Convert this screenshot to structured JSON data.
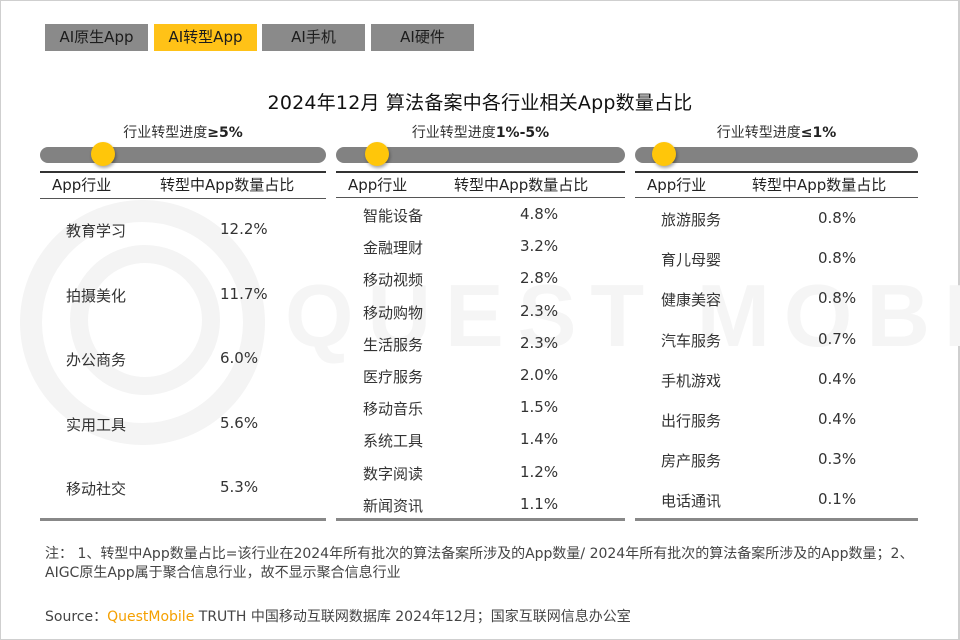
{
  "tabs": [
    {
      "label": "AI原生App",
      "active": false
    },
    {
      "label": "AI转型App",
      "active": true
    },
    {
      "label": "AI手机",
      "active": false
    },
    {
      "label": "AI硬件",
      "active": false
    }
  ],
  "title": "2024年12月 算法备案中各行业相关App数量占比",
  "watermark": "QUEST MOBILE",
  "columns": {
    "industry": "App行业",
    "share": "转型中App数量占比"
  },
  "panels": [
    {
      "caption_prefix": "行业转型进度",
      "caption_value": "≥5%",
      "slider_level": 0.18,
      "rows": [
        {
          "name": "教育学习",
          "value": "12.2%"
        },
        {
          "name": "拍摄美化",
          "value": "11.7%"
        },
        {
          "name": "办公商务",
          "value": "6.0%"
        },
        {
          "name": "实用工具",
          "value": "5.6%"
        },
        {
          "name": "移动社交",
          "value": "5.3%"
        }
      ]
    },
    {
      "caption_prefix": "行业转型进度",
      "caption_value": "1%-5%",
      "slider_level": 0.1,
      "rows": [
        {
          "name": "智能设备",
          "value": "4.8%"
        },
        {
          "name": "金融理财",
          "value": "3.2%"
        },
        {
          "name": "移动视频",
          "value": "2.8%"
        },
        {
          "name": "移动购物",
          "value": "2.3%"
        },
        {
          "name": "生活服务",
          "value": "2.3%"
        },
        {
          "name": "医疗服务",
          "value": "2.0%"
        },
        {
          "name": "移动音乐",
          "value": "1.5%"
        },
        {
          "name": "系统工具",
          "value": "1.4%"
        },
        {
          "name": "数字阅读",
          "value": "1.2%"
        },
        {
          "name": "新闻资讯",
          "value": "1.1%"
        }
      ]
    },
    {
      "caption_prefix": "行业转型进度",
      "caption_value": "≤1%",
      "slider_level": 0.06,
      "rows": [
        {
          "name": "旅游服务",
          "value": "0.8%"
        },
        {
          "name": "育儿母婴",
          "value": "0.8%"
        },
        {
          "name": "健康美容",
          "value": "0.8%"
        },
        {
          "name": "汽车服务",
          "value": "0.7%"
        },
        {
          "name": "手机游戏",
          "value": "0.4%"
        },
        {
          "name": "出行服务",
          "value": "0.4%"
        },
        {
          "name": "房产服务",
          "value": "0.3%"
        },
        {
          "name": "电话通讯",
          "value": "0.1%"
        }
      ]
    }
  ],
  "note": "注： 1、转型中App数量占比=该行业在2024年所有批次的算法备案所涉及的App数量/ 2024年所有批次的算法备案所涉及的App数量；2、AIGC原生App属于聚合信息行业，故不显示聚合信息行业",
  "source": {
    "prefix": "Source：",
    "brand": "QuestMobile",
    "suffix": " TRUTH 中国移动互联网数据库 2024年12月；国家互联网信息办公室"
  },
  "colors": {
    "accent": "#ffc217",
    "tab_inactive": "#8a8a8a",
    "slider_track": "#828282",
    "slider_thumb": "#ffc60a",
    "brand": "#f5a000"
  }
}
